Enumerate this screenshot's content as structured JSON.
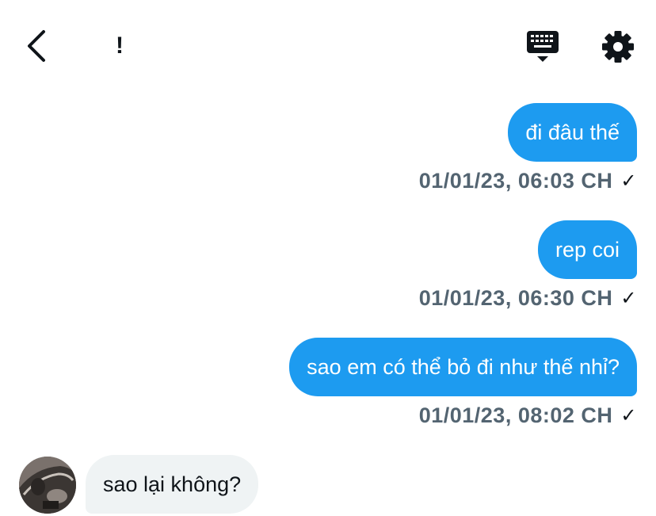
{
  "header": {
    "back_icon": "chevron-left-icon",
    "alert_label": "!",
    "keyboard_icon": "keyboard-icon",
    "settings_icon": "gear-icon"
  },
  "messages": [
    {
      "direction": "outgoing",
      "text": "đi đâu thế",
      "time": "01/01/23, 06:03 CH",
      "status": "✓"
    },
    {
      "direction": "outgoing",
      "text": "rep coi",
      "time": "01/01/23, 06:30 CH",
      "status": "✓"
    },
    {
      "direction": "outgoing",
      "text": "sao em có thể bỏ đi như thế nhỉ?",
      "time": "01/01/23, 08:02 CH",
      "status": "✓"
    },
    {
      "direction": "incoming",
      "text": "sao lại không?"
    }
  ],
  "colors": {
    "outgoing_bubble": "#1d9bf0",
    "incoming_bubble": "#eff3f4",
    "meta_text": "#536471"
  }
}
